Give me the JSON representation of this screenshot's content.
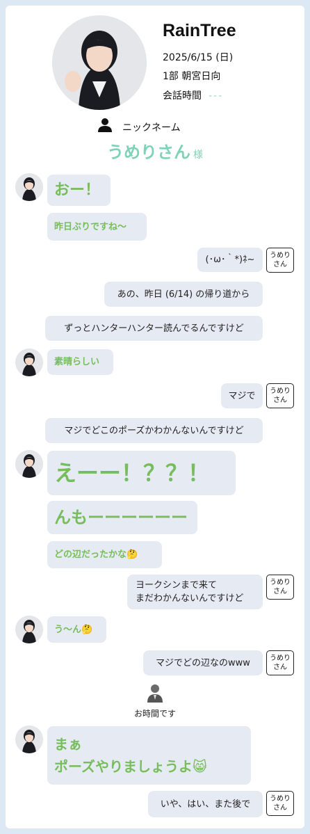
{
  "profile": {
    "name": "RainTree",
    "date": "2025/6/15 (日)",
    "session": "1部  朝宮日向",
    "talk_time_label": "会話時間",
    "talk_time_value": "---"
  },
  "nickname": {
    "label": "ニックネーム",
    "value": "うめりさん",
    "suffix": "様"
  },
  "user_tag": [
    "うめり",
    "さん"
  ],
  "messages": {
    "m1": "おー！",
    "m2": "昨日ぶりですね〜",
    "u1": "(･ω･｀*)ﾈ~",
    "u2": "あの、昨日 (6/14) の帰り道から",
    "u3": "ずっとハンターハンター読んでるんですけど",
    "m3": "素晴らしい",
    "u4": "マジで",
    "u5": "マジでどこのポーズかわかんないんですけど",
    "m4": "えーー！？？！",
    "m5": "んもーーーーーー",
    "m6": "どの辺だったかな🤔",
    "u6a": "ヨークシンまで来て",
    "u6b": "まだわかんないんですけど",
    "m7": "う〜ん🤔",
    "u7": "マジでどの辺なのwww",
    "m8a": "まぁ",
    "m8b": "ポーズやりましょうよ😸",
    "u8": "いや、はい、また後で"
  },
  "system": {
    "notice": "お時間です"
  },
  "colors": {
    "accent": "#7ed2b7",
    "idol_text": "#76bd5b",
    "bubble": "#e6eaf3",
    "frame": "#dce9f5"
  }
}
